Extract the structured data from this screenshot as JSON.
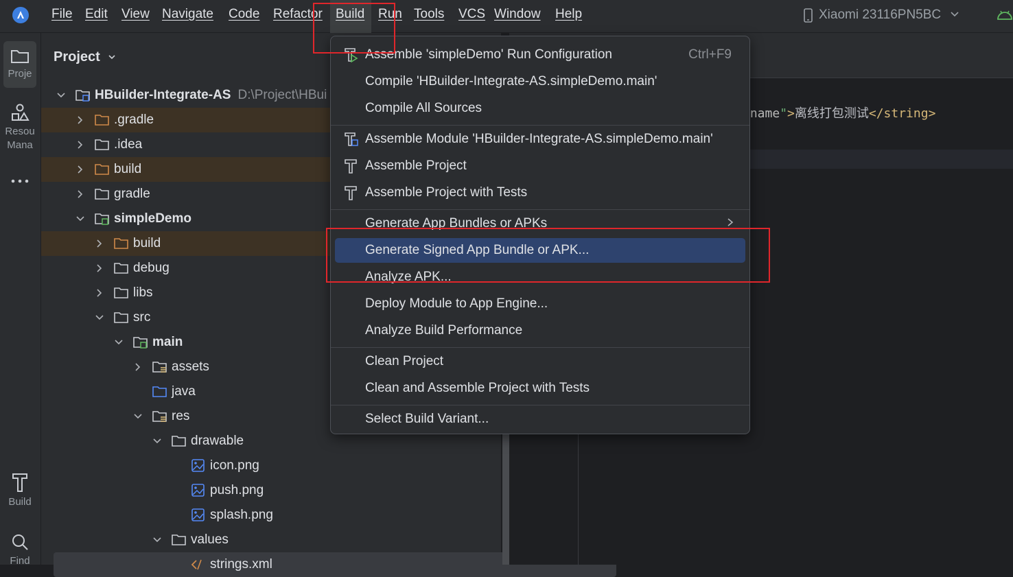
{
  "menubar": {
    "items": [
      "File",
      "Edit",
      "View",
      "Navigate",
      "Code",
      "Refactor",
      "Build",
      "Run",
      "Tools",
      "VCS",
      "Window",
      "Help"
    ],
    "device": "Xiaomi 23116PN5BC"
  },
  "toolstrip": {
    "project": "Proje",
    "resource_1": "Resou",
    "resource_2": "Mana",
    "build": "Build",
    "find": "Find"
  },
  "project_panel": {
    "title": "Project",
    "root_name": "HBuilder-Integrate-AS",
    "root_path": "D:\\Project\\HBui",
    "tree": [
      {
        "label": ".gradle",
        "depth": 1,
        "expanded": false,
        "icon": "folder-excluded",
        "excluded": true
      },
      {
        "label": ".idea",
        "depth": 1,
        "expanded": false,
        "icon": "folder"
      },
      {
        "label": "build",
        "depth": 1,
        "expanded": false,
        "icon": "folder-excluded",
        "excluded": true
      },
      {
        "label": "gradle",
        "depth": 1,
        "expanded": false,
        "icon": "folder"
      },
      {
        "label": "simpleDemo",
        "depth": 1,
        "expanded": true,
        "icon": "module-folder",
        "bold": true
      },
      {
        "label": "build",
        "depth": 2,
        "expanded": false,
        "icon": "folder-excluded",
        "excluded": true
      },
      {
        "label": "debug",
        "depth": 2,
        "expanded": false,
        "icon": "folder"
      },
      {
        "label": "libs",
        "depth": 2,
        "expanded": false,
        "icon": "folder"
      },
      {
        "label": "src",
        "depth": 2,
        "expanded": true,
        "icon": "folder"
      },
      {
        "label": "main",
        "depth": 3,
        "expanded": true,
        "icon": "module-folder",
        "bold": true
      },
      {
        "label": "assets",
        "depth": 4,
        "expanded": false,
        "icon": "resource-folder"
      },
      {
        "label": "java",
        "depth": 4,
        "leaf": true,
        "icon": "source-folder"
      },
      {
        "label": "res",
        "depth": 4,
        "expanded": true,
        "icon": "resource-folder"
      },
      {
        "label": "drawable",
        "depth": 5,
        "expanded": true,
        "icon": "folder"
      },
      {
        "label": "icon.png",
        "depth": 6,
        "leaf": true,
        "icon": "image-file"
      },
      {
        "label": "push.png",
        "depth": 6,
        "leaf": true,
        "icon": "image-file"
      },
      {
        "label": "splash.png",
        "depth": 6,
        "leaf": true,
        "icon": "image-file"
      },
      {
        "label": "values",
        "depth": 5,
        "expanded": true,
        "icon": "folder"
      },
      {
        "label": "strings.xml",
        "depth": 6,
        "leaf": true,
        "icon": "xml-file",
        "selected": true
      }
    ]
  },
  "editor": {
    "code_attr": "_name",
    "code_quote_open": "\"",
    "code_close_angle": ">",
    "code_text": "离线打包测试",
    "code_close_tag": "</string>"
  },
  "build_menu": {
    "items": [
      {
        "label": "Assemble 'simpleDemo' Run Configuration",
        "shortcut": "Ctrl+F9",
        "icon": "assemble-run-icon"
      },
      {
        "label": "Compile 'HBuilder-Integrate-AS.simpleDemo.main'",
        "icon": ""
      },
      {
        "label": "Compile All Sources",
        "icon": ""
      },
      {
        "separator": true
      },
      {
        "label": "Assemble Module 'HBuilder-Integrate-AS.simpleDemo.main'",
        "icon": "assemble-module-icon"
      },
      {
        "label": "Assemble Project",
        "icon": "hammer-icon"
      },
      {
        "label": "Assemble Project with Tests",
        "icon": "hammer-icon"
      },
      {
        "separator": true
      },
      {
        "label": "Generate App Bundles or APKs",
        "submenu": true
      },
      {
        "label": "Generate Signed App Bundle or APK...",
        "highlighted": true
      },
      {
        "label": "Analyze APK..."
      },
      {
        "label": "Deploy Module to App Engine..."
      },
      {
        "label": "Analyze Build Performance"
      },
      {
        "separator": true
      },
      {
        "label": "Clean Project"
      },
      {
        "label": "Clean and Assemble Project with Tests"
      },
      {
        "separator": true
      },
      {
        "label": "Select Build Variant..."
      }
    ]
  },
  "colors": {
    "highlight": "#2e436e",
    "annotation": "#e0262b",
    "excluded_row": "#3d3224",
    "folder_orange": "#d08a4a",
    "folder_blue": "#548af7"
  }
}
